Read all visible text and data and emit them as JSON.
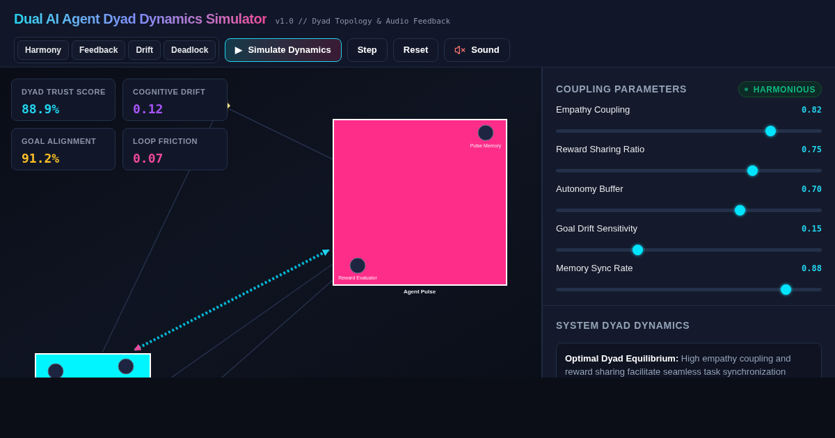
{
  "header": {
    "title": "Dual AI Agent Dyad Dynamics Simulator",
    "subtitle": "v1.0 // Dyad Topology & Audio Feedback",
    "presets": [
      {
        "label": "Harmony",
        "selected": false
      },
      {
        "label": "Feedback",
        "selected": false
      },
      {
        "label": "Drift",
        "selected": false
      },
      {
        "label": "Deadlock",
        "selected": false
      }
    ],
    "simulate": {
      "icon": "▶",
      "label": "Simulate Dynamics"
    },
    "buttons": [
      "Step",
      "Reset"
    ],
    "sound": {
      "label": "Sound",
      "muted": true
    }
  },
  "metrics": [
    {
      "label": "DYAD TRUST SCORE",
      "value": "88.9%",
      "color": "#22d3ee"
    },
    {
      "label": "COGNITIVE DRIFT",
      "value": "0.12",
      "color": "#a855f7"
    },
    {
      "label": "GOAL ALIGNMENT",
      "value": "91.2%",
      "color": "#fbbf24"
    },
    {
      "label": "LOOP FRICTION",
      "value": "0.07",
      "color": "#ec4899"
    }
  ],
  "agents": [
    {
      "name": "Agent Pulse",
      "color": "#ff2d8a",
      "nodes": [
        "Pulse Memory",
        "Reward Evaluator"
      ]
    },
    {
      "color": "#00f5ff"
    }
  ],
  "coupling": {
    "title": "COUPLING PARAMETERS",
    "status": "HARMONIOUS",
    "params": [
      {
        "label": "Empathy Coupling",
        "reading": "0.82",
        "level": 0.82
      },
      {
        "label": "Reward Sharing Ratio",
        "reading": "0.75",
        "level": 0.75
      },
      {
        "label": "Autonomy Buffer",
        "reading": "0.70",
        "level": 0.7
      },
      {
        "label": "Goal Drift Sensitivity",
        "reading": "0.15",
        "level": 0.3
      },
      {
        "label": "Memory Sync Rate",
        "reading": "0.88",
        "level": 0.88
      }
    ]
  },
  "dynamics": {
    "title": "SYSTEM DYAD DYNAMICS",
    "text": "**Optimal Dyad Equilibrium:** High empathy coupling and reward sharing facilitate seamless task synchronization"
  }
}
